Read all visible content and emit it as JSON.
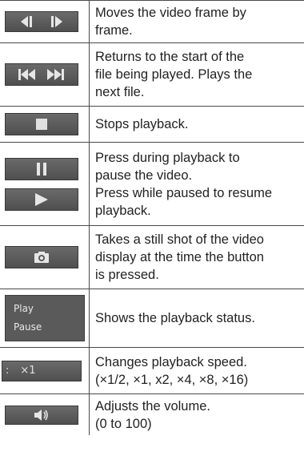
{
  "rows": [
    {
      "icons": [
        "frame-back-icon",
        "frame-forward-icon"
      ],
      "text": "Moves the video frame by\nframe."
    },
    {
      "icons": [
        "skip-to-start-icon",
        "skip-to-next-icon"
      ],
      "text": "Returns to the start of the\nfile being played. Plays the\nnext file."
    },
    {
      "icons": [
        "stop-icon"
      ],
      "text": "Stops playback."
    },
    {
      "icons": [
        "pause-icon",
        "play-icon"
      ],
      "text": "Press during playback to\npause the video.\nPress while paused to resume\nplayback."
    },
    {
      "icons": [
        "camera-icon"
      ],
      "text": "Takes a still shot of the video\ndisplay at the time the button\nis pressed."
    },
    {
      "status": {
        "play_label": "Play",
        "pause_label": "Pause"
      },
      "text": "Shows the playback status."
    },
    {
      "speed_label": "×1",
      "speed_prefix": ":",
      "text": "Changes playback speed.\n(×1/2, ×1, x2, ×4, ×8, ×16)"
    },
    {
      "icons": [
        "volume-icon"
      ],
      "text": "Adjusts the volume.\n(0 to 100)"
    }
  ]
}
